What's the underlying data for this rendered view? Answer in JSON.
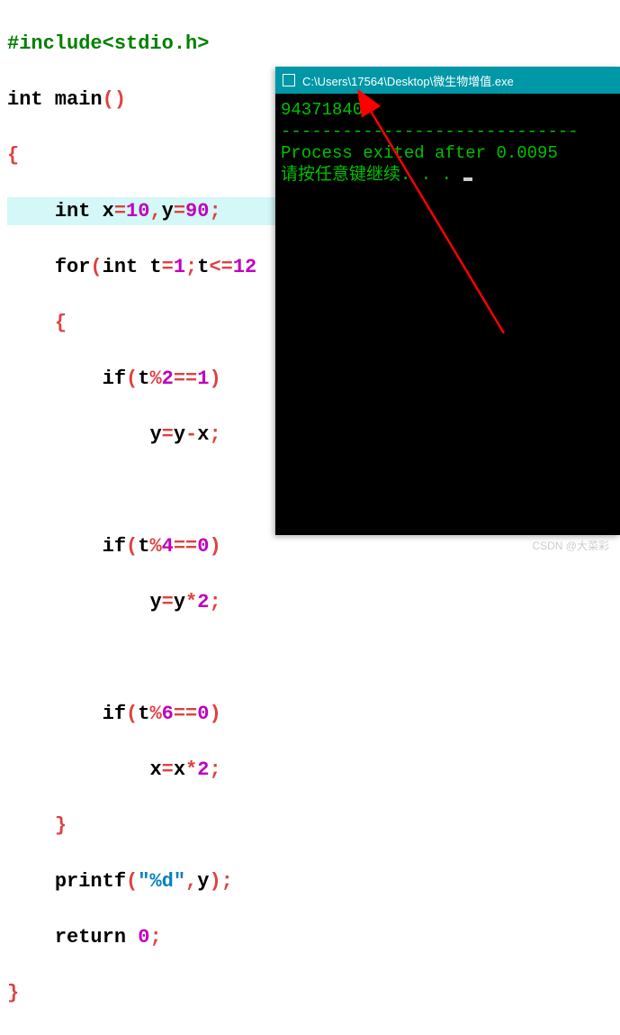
{
  "code": {
    "l1_include": "#include<stdio.h>",
    "l2_int": "int",
    "l2_main": " main",
    "l2_paren": "()",
    "l3_brace": "{",
    "l4_indent": "    ",
    "l4_int": "int",
    "l4_rest_a": " x",
    "l4_eq1": "=",
    "l4_10": "10",
    "l4_comma": ",",
    "l4_y": "y",
    "l4_eq2": "=",
    "l4_90": "90",
    "l4_semi": ";",
    "l5_indent": "    ",
    "l5_for": "for",
    "l5_p1": "(",
    "l5_int": "int",
    "l5_sp": " t",
    "l5_eq": "=",
    "l5_1": "1",
    "l5_semi": ";",
    "l5_t2": "t",
    "l5_le": "<=",
    "l5_12": "12",
    "l6_indent": "    ",
    "l6_brace": "{",
    "l7_indent": "        ",
    "l7_if": "if",
    "l7_p1": "(",
    "l7_t": "t",
    "l7_mod": "%",
    "l7_2": "2",
    "l7_eq": "==",
    "l7_1": "1",
    "l7_p2": ")",
    "l8_indent": "            ",
    "l8_y": "y",
    "l8_eq": "=",
    "l8_y2": "y",
    "l8_minus": "-",
    "l8_x": "x",
    "l8_semi": ";",
    "l10_indent": "        ",
    "l10_if": "if",
    "l10_p1": "(",
    "l10_t": "t",
    "l10_mod": "%",
    "l10_4": "4",
    "l10_eq": "==",
    "l10_0": "0",
    "l10_p2": ")",
    "l11_indent": "            ",
    "l11_y": "y",
    "l11_eq": "=",
    "l11_y2": "y",
    "l11_mul": "*",
    "l11_2": "2",
    "l11_semi": ";",
    "l13_indent": "        ",
    "l13_if": "if",
    "l13_p1": "(",
    "l13_t": "t",
    "l13_mod": "%",
    "l13_6": "6",
    "l13_eq": "==",
    "l13_0": "0",
    "l13_p2": ")",
    "l14_indent": "            ",
    "l14_x": "x",
    "l14_eq": "=",
    "l14_x2": "x",
    "l14_mul": "*",
    "l14_2": "2",
    "l14_semi": ";",
    "l15_indent": "    ",
    "l15_brace": "}",
    "l16_indent": "    ",
    "l16_printf": "printf",
    "l16_p1": "(",
    "l16_str": "\"%d\"",
    "l16_comma": ",",
    "l16_y": "y",
    "l16_p2": ")",
    "l16_semi": ";",
    "l17_indent": "    ",
    "l17_return": "return",
    "l17_sp": " ",
    "l17_0": "0",
    "l17_semi": ";",
    "l18_brace": "}"
  },
  "console": {
    "title": "C:\\Users\\17564\\Desktop\\微生物增值.exe",
    "output": "94371840",
    "dashes": "-----------------------------",
    "exit_line": "Process exited after 0.0095",
    "press_key": "请按任意键继续. . . "
  },
  "watermark": "CSDN @大菜彩"
}
